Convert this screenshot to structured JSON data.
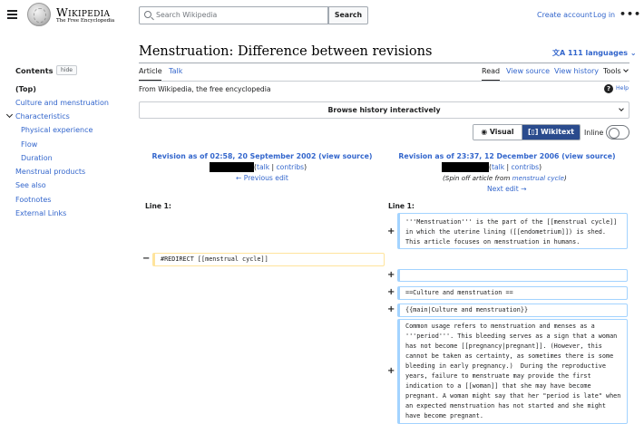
{
  "header": {
    "wordmark": "Wikipedia",
    "tagline": "The Free Encyclopedia",
    "search_placeholder": "Search Wikipedia",
    "search_button": "Search",
    "create_account": "Create account",
    "login": "Log in",
    "more": "•••"
  },
  "sidebar": {
    "title": "Contents",
    "hide": "hide",
    "items": [
      "(Top)",
      "Culture and menstruation",
      "Characteristics",
      "Physical experience",
      "Flow",
      "Duration",
      "Menstrual products",
      "See also",
      "Footnotes",
      "External Links"
    ]
  },
  "page": {
    "title": "Menstruation: Difference between revisions",
    "languages": "111 languages",
    "tabs_left": [
      "Article",
      "Talk"
    ],
    "tabs_right": [
      "Read",
      "View source",
      "View history",
      "Tools"
    ],
    "subtitle": "From Wikipedia, the free encyclopedia",
    "help": "Help",
    "browse": "Browse history interactively",
    "visual": "Visual",
    "wikitext": "Wikitext",
    "inline": "Inline"
  },
  "diff": {
    "left": {
      "revision": "Revision as of 02:58, 20 September 2002",
      "view_source": "(view source)",
      "talk": "talk",
      "contribs": "contribs",
      "prev": "← Previous edit"
    },
    "right": {
      "revision": "Revision as of 23:37, 12 December 2006",
      "view_source": "(view source)",
      "talk": "talk",
      "contribs": "contribs",
      "note_prefix": "(Spin off article from ",
      "note_link": "menstrual cycle",
      "note_suffix": ")",
      "next": "Next edit →"
    },
    "line_label": "Line 1:",
    "deleted": "#REDIRECT [[menstrual cycle]]",
    "added": [
      "'''Menstruation''' is the part of the [[menstrual cycle]] in which the uterine lining ([[endometrium]]) is shed. This article focuses on menstruation in humans.",
      "",
      "==Culture and menstruation ==",
      "{{main|Culture and menstruation}}",
      "Common usage refers to menstruation and menses as a '''period'''. This bleeding serves as a sign that a woman has not become [[pregnancy|pregnant]]. (However, this cannot be taken as certainty, as sometimes there is some bleeding in early pregnancy.)  During the reproductive years, failure to menstruate may provide the first indication to a [[woman]] that she may have become pregnant. A woman might say that her \"period is late\" when an expected menstruation has not started and she might have become pregnant."
    ]
  }
}
